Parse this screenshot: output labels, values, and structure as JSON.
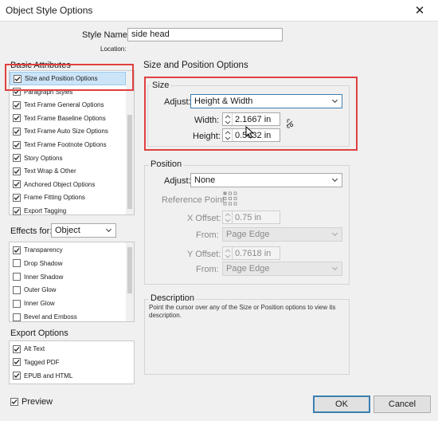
{
  "window": {
    "title": "Object Style Options",
    "close_glyph": "✕"
  },
  "header": {
    "style_name_label": "Style Name:",
    "style_name_value": "side head",
    "location_label": "Location:"
  },
  "sidebar": {
    "basic_attributes_title": "Basic Attributes",
    "basic_items": [
      {
        "label": "Size and Position Options",
        "checked": true,
        "selected": true
      },
      {
        "label": "Paragraph Styles",
        "checked": true
      },
      {
        "label": "Text Frame General Options",
        "checked": true
      },
      {
        "label": "Text Frame Baseline Options",
        "checked": true
      },
      {
        "label": "Text Frame Auto Size Options",
        "checked": true
      },
      {
        "label": "Text Frame Footnote Options",
        "checked": true
      },
      {
        "label": "Story Options",
        "checked": true
      },
      {
        "label": "Text Wrap & Other",
        "checked": true
      },
      {
        "label": "Anchored Object Options",
        "checked": true
      },
      {
        "label": "Frame Fitting Options",
        "checked": true
      },
      {
        "label": "Export Tagging",
        "checked": true
      }
    ],
    "effects_label": "Effects for:",
    "effects_value": "Object",
    "effects_items": [
      {
        "label": "Transparency",
        "checked": true
      },
      {
        "label": "Drop Shadow",
        "checked": false
      },
      {
        "label": "Inner Shadow",
        "checked": false
      },
      {
        "label": "Outer Glow",
        "checked": false
      },
      {
        "label": "Inner Glow",
        "checked": false
      },
      {
        "label": "Bevel and Emboss",
        "checked": false
      }
    ],
    "export_title": "Export Options",
    "export_items": [
      {
        "label": "Alt Text",
        "checked": true
      },
      {
        "label": "Tagged PDF",
        "checked": true
      },
      {
        "label": "EPUB and HTML",
        "checked": true
      }
    ]
  },
  "main": {
    "section_title": "Size and Position Options",
    "size": {
      "title": "Size",
      "adjust_label": "Adjust:",
      "adjust_value": "Height & Width",
      "width_label": "Width:",
      "width_value": "2.1667 in",
      "height_label": "Height:",
      "height_value": "0.5632 in"
    },
    "position": {
      "title": "Position",
      "adjust_label": "Adjust:",
      "adjust_value": "None",
      "reference_point_label": "Reference Point:",
      "x_offset_label": "X Offset:",
      "x_offset_value": "0.75 in",
      "x_from_label": "From:",
      "x_from_value": "Page Edge",
      "y_offset_label": "Y Offset:",
      "y_offset_value": "0.7618 in",
      "y_from_label": "From:",
      "y_from_value": "Page Edge"
    },
    "description": {
      "title": "Description",
      "text": "Point the cursor over any of the Size or Position options to view its description."
    }
  },
  "footer": {
    "preview_label": "Preview",
    "preview_checked": true,
    "ok_label": "OK",
    "cancel_label": "Cancel"
  },
  "colors": {
    "highlight_box": "#e04040",
    "selection": "#cce4f7",
    "focus_border": "#3c7fb1"
  }
}
